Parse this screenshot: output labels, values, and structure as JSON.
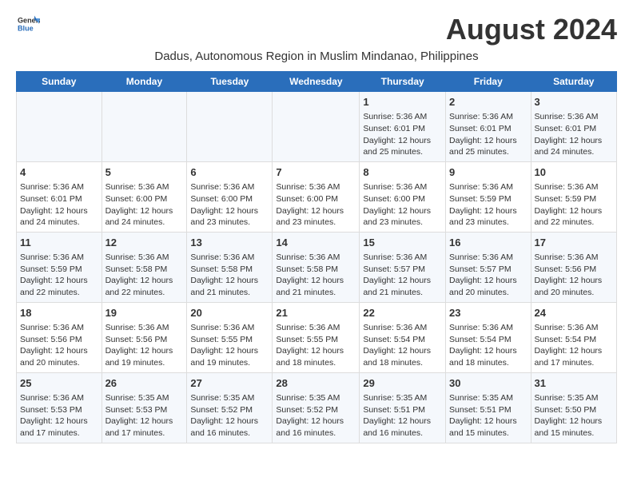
{
  "header": {
    "logo_general": "General",
    "logo_blue": "Blue",
    "month_year": "August 2024",
    "subtitle": "Dadus, Autonomous Region in Muslim Mindanao, Philippines"
  },
  "days_of_week": [
    "Sunday",
    "Monday",
    "Tuesday",
    "Wednesday",
    "Thursday",
    "Friday",
    "Saturday"
  ],
  "weeks": [
    [
      {
        "day": "",
        "info": ""
      },
      {
        "day": "",
        "info": ""
      },
      {
        "day": "",
        "info": ""
      },
      {
        "day": "",
        "info": ""
      },
      {
        "day": "1",
        "info": "Sunrise: 5:36 AM\nSunset: 6:01 PM\nDaylight: 12 hours and 25 minutes."
      },
      {
        "day": "2",
        "info": "Sunrise: 5:36 AM\nSunset: 6:01 PM\nDaylight: 12 hours and 25 minutes."
      },
      {
        "day": "3",
        "info": "Sunrise: 5:36 AM\nSunset: 6:01 PM\nDaylight: 12 hours and 24 minutes."
      }
    ],
    [
      {
        "day": "4",
        "info": "Sunrise: 5:36 AM\nSunset: 6:01 PM\nDaylight: 12 hours and 24 minutes."
      },
      {
        "day": "5",
        "info": "Sunrise: 5:36 AM\nSunset: 6:00 PM\nDaylight: 12 hours and 24 minutes."
      },
      {
        "day": "6",
        "info": "Sunrise: 5:36 AM\nSunset: 6:00 PM\nDaylight: 12 hours and 23 minutes."
      },
      {
        "day": "7",
        "info": "Sunrise: 5:36 AM\nSunset: 6:00 PM\nDaylight: 12 hours and 23 minutes."
      },
      {
        "day": "8",
        "info": "Sunrise: 5:36 AM\nSunset: 6:00 PM\nDaylight: 12 hours and 23 minutes."
      },
      {
        "day": "9",
        "info": "Sunrise: 5:36 AM\nSunset: 5:59 PM\nDaylight: 12 hours and 23 minutes."
      },
      {
        "day": "10",
        "info": "Sunrise: 5:36 AM\nSunset: 5:59 PM\nDaylight: 12 hours and 22 minutes."
      }
    ],
    [
      {
        "day": "11",
        "info": "Sunrise: 5:36 AM\nSunset: 5:59 PM\nDaylight: 12 hours and 22 minutes."
      },
      {
        "day": "12",
        "info": "Sunrise: 5:36 AM\nSunset: 5:58 PM\nDaylight: 12 hours and 22 minutes."
      },
      {
        "day": "13",
        "info": "Sunrise: 5:36 AM\nSunset: 5:58 PM\nDaylight: 12 hours and 21 minutes."
      },
      {
        "day": "14",
        "info": "Sunrise: 5:36 AM\nSunset: 5:58 PM\nDaylight: 12 hours and 21 minutes."
      },
      {
        "day": "15",
        "info": "Sunrise: 5:36 AM\nSunset: 5:57 PM\nDaylight: 12 hours and 21 minutes."
      },
      {
        "day": "16",
        "info": "Sunrise: 5:36 AM\nSunset: 5:57 PM\nDaylight: 12 hours and 20 minutes."
      },
      {
        "day": "17",
        "info": "Sunrise: 5:36 AM\nSunset: 5:56 PM\nDaylight: 12 hours and 20 minutes."
      }
    ],
    [
      {
        "day": "18",
        "info": "Sunrise: 5:36 AM\nSunset: 5:56 PM\nDaylight: 12 hours and 20 minutes."
      },
      {
        "day": "19",
        "info": "Sunrise: 5:36 AM\nSunset: 5:56 PM\nDaylight: 12 hours and 19 minutes."
      },
      {
        "day": "20",
        "info": "Sunrise: 5:36 AM\nSunset: 5:55 PM\nDaylight: 12 hours and 19 minutes."
      },
      {
        "day": "21",
        "info": "Sunrise: 5:36 AM\nSunset: 5:55 PM\nDaylight: 12 hours and 18 minutes."
      },
      {
        "day": "22",
        "info": "Sunrise: 5:36 AM\nSunset: 5:54 PM\nDaylight: 12 hours and 18 minutes."
      },
      {
        "day": "23",
        "info": "Sunrise: 5:36 AM\nSunset: 5:54 PM\nDaylight: 12 hours and 18 minutes."
      },
      {
        "day": "24",
        "info": "Sunrise: 5:36 AM\nSunset: 5:54 PM\nDaylight: 12 hours and 17 minutes."
      }
    ],
    [
      {
        "day": "25",
        "info": "Sunrise: 5:36 AM\nSunset: 5:53 PM\nDaylight: 12 hours and 17 minutes."
      },
      {
        "day": "26",
        "info": "Sunrise: 5:35 AM\nSunset: 5:53 PM\nDaylight: 12 hours and 17 minutes."
      },
      {
        "day": "27",
        "info": "Sunrise: 5:35 AM\nSunset: 5:52 PM\nDaylight: 12 hours and 16 minutes."
      },
      {
        "day": "28",
        "info": "Sunrise: 5:35 AM\nSunset: 5:52 PM\nDaylight: 12 hours and 16 minutes."
      },
      {
        "day": "29",
        "info": "Sunrise: 5:35 AM\nSunset: 5:51 PM\nDaylight: 12 hours and 16 minutes."
      },
      {
        "day": "30",
        "info": "Sunrise: 5:35 AM\nSunset: 5:51 PM\nDaylight: 12 hours and 15 minutes."
      },
      {
        "day": "31",
        "info": "Sunrise: 5:35 AM\nSunset: 5:50 PM\nDaylight: 12 hours and 15 minutes."
      }
    ]
  ]
}
